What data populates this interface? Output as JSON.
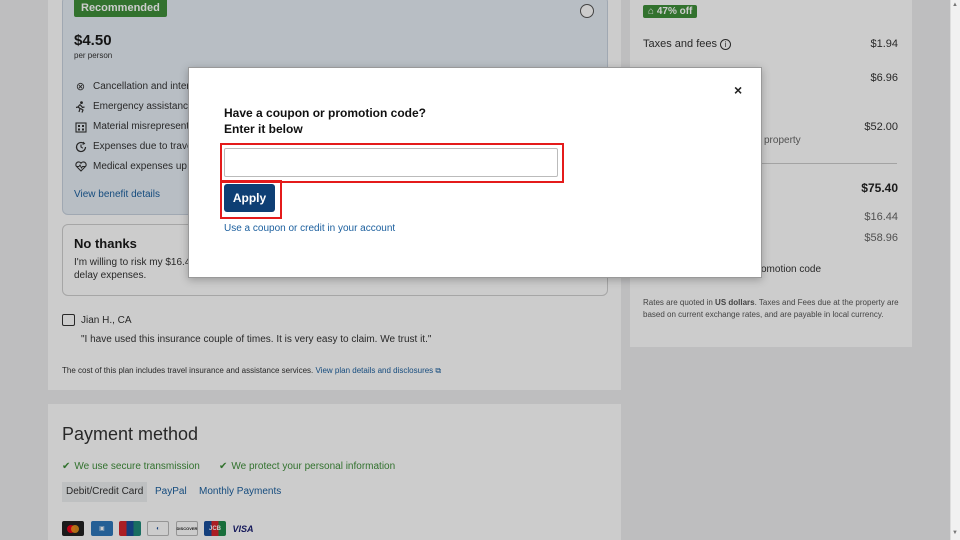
{
  "insurance": {
    "recommended_badge": "Recommended",
    "price": "$4.50",
    "per_person": "per person",
    "benefits": [
      {
        "icon": "cancel-circle-icon",
        "text": "Cancellation and inter"
      },
      {
        "icon": "running-person-icon",
        "text": "Emergency assistance"
      },
      {
        "icon": "building-icon",
        "text": "Material misrepresent"
      },
      {
        "icon": "clock-refresh-icon",
        "text": "Expenses due to trave"
      },
      {
        "icon": "heartbeat-icon",
        "text": "Medical expenses up"
      }
    ],
    "view_benefit_details": "View benefit details",
    "no_thanks_title": "No thanks",
    "no_thanks_text_1": "I'm willing to risk my $16.4",
    "no_thanks_text_2": "delay expenses.",
    "review_name": "Jian H., CA",
    "review_quote": "\"I have used this insurance couple of times. It is very easy to claim. We trust it.\"",
    "cost_note": "The cost of this plan includes travel insurance and assistance services.",
    "cost_link": "View plan details and disclosures"
  },
  "payment": {
    "title": "Payment method",
    "secure_1": "We use secure transmission",
    "secure_2": "We protect your personal information",
    "tabs": [
      "Debit/Credit Card",
      "PayPal",
      "Monthly Payments"
    ],
    "cards": [
      "mastercard",
      "amex",
      "unionpay",
      "diners",
      "discover",
      "jcb",
      "visa"
    ],
    "visa_label": "VISA",
    "discover_label": "DISCOVER",
    "jcb_label": "JCB"
  },
  "summary": {
    "off_badge": "47% off",
    "taxes_label": "Taxes and fees",
    "taxes_value": "$1.94",
    "row2_value": "$6.96",
    "row3_value": "$52.00",
    "row3_sub": "property",
    "total_value": "$75.40",
    "val_a": "$16.44",
    "val_b": "$58.96",
    "promo_link_partial": "omotion code",
    "rates_note_1": "Rates are quoted in ",
    "rates_note_bold": "US dollars",
    "rates_note_2": ". Taxes and Fees due at the property are based on current exchange rates, and are payable in local currency."
  },
  "modal": {
    "close": "×",
    "title_1": "Have a coupon or promotion code?",
    "title_2": "Enter it below",
    "input_value": "",
    "input_placeholder": "",
    "apply_label": "Apply",
    "coupon_link": "Use a coupon or credit in your account"
  },
  "colors": {
    "primary_button": "#0e3f74",
    "highlight": "#e41b1b",
    "success": "#3f8f3a",
    "link": "#1b5f9e"
  }
}
